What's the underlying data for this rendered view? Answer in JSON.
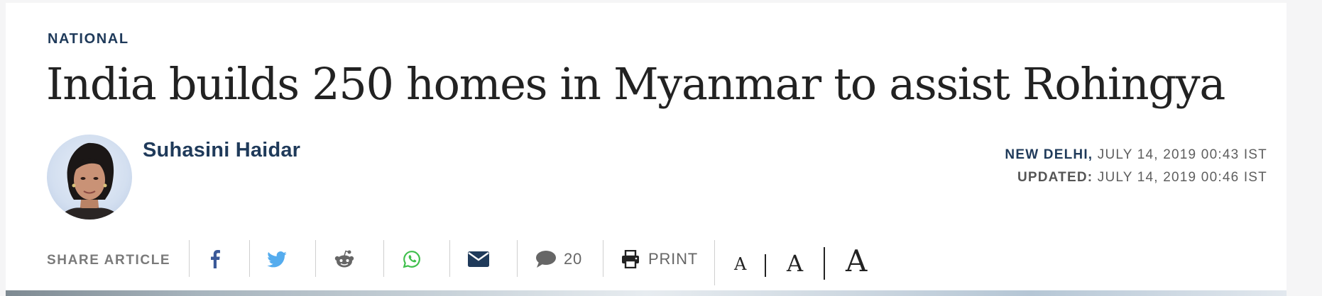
{
  "article": {
    "section": "NATIONAL",
    "headline": "India builds 250 homes in Myanmar to assist Rohingya",
    "author": "Suhasini Haidar",
    "dateline_location": "NEW DELHI,",
    "dateline_date": "JULY 14, 2019 00:43 IST",
    "updated_label": "UPDATED:",
    "updated_date": "JULY 14, 2019 00:46 IST"
  },
  "share": {
    "label": "SHARE ARTICLE",
    "comments_count": "20",
    "print_label": "PRINT",
    "icons": [
      "facebook-icon",
      "twitter-icon",
      "reddit-icon",
      "whatsapp-icon",
      "email-icon",
      "comment-icon",
      "printer-icon"
    ]
  },
  "font_size_controls": [
    "A",
    "A",
    "A"
  ],
  "colors": {
    "navy": "#1f3a5a",
    "facebook": "#3b5998",
    "twitter": "#55acee",
    "whatsapp": "#3fbf4c",
    "email": "#1f3a5a"
  }
}
